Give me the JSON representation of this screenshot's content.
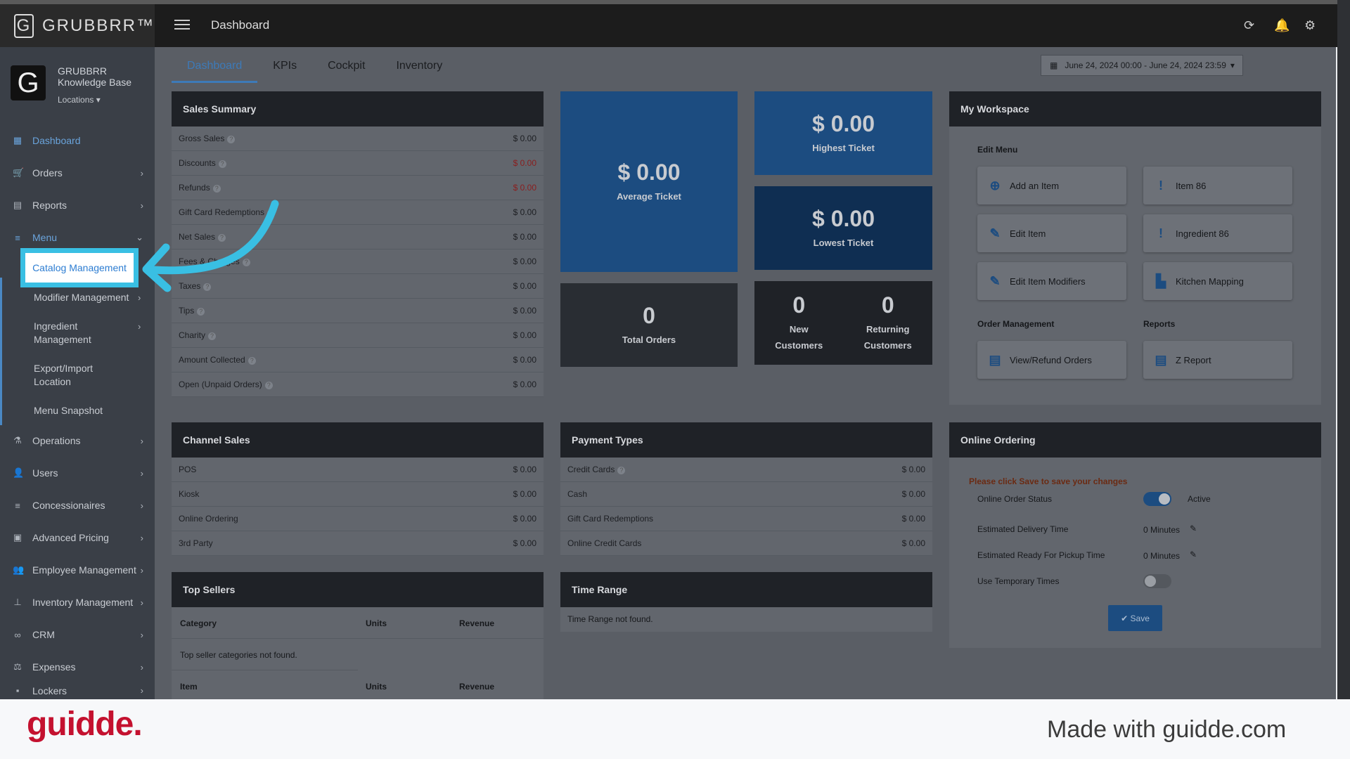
{
  "app": {
    "logo_text": "GRUBBRR™",
    "page_title": "Dashboard"
  },
  "topbar_icons": [
    "refresh-icon",
    "bell-icon",
    "gear-icon"
  ],
  "sidebar": {
    "brand_name_line1": "GRUBBRR",
    "brand_name_line2": "Knowledge Base",
    "locations": "Locations ▾",
    "items": [
      {
        "label": "Dashboard",
        "icon": "dashboard-icon"
      },
      {
        "label": "Orders",
        "icon": "cart-icon"
      },
      {
        "label": "Reports",
        "icon": "report-icon"
      },
      {
        "label": "Menu",
        "icon": "list-icon"
      },
      {
        "label": "Operations",
        "icon": "flask-icon"
      },
      {
        "label": "Users",
        "icon": "users-icon"
      },
      {
        "label": "Concessionaires",
        "icon": "list-icon"
      },
      {
        "label": "Advanced Pricing",
        "icon": "money-icon"
      },
      {
        "label": "Employee Management",
        "icon": "group-icon"
      },
      {
        "label": "Inventory Management",
        "icon": "sitemap-icon"
      },
      {
        "label": "CRM",
        "icon": "link-icon"
      },
      {
        "label": "Expenses",
        "icon": "scale-icon"
      },
      {
        "label": "Lockers",
        "icon": "lock-icon"
      }
    ],
    "menu_sub": {
      "catalog": "Catalog Management",
      "modifier": "Modifier Management",
      "ingredient_l1": "Ingredient",
      "ingredient_l2": "Management",
      "export_l1": "Export/Import",
      "export_l2": "Location",
      "snapshot": "Menu Snapshot"
    }
  },
  "tabs": [
    "Dashboard",
    "KPIs",
    "Cockpit",
    "Inventory"
  ],
  "date_range": "June 24, 2024 00:00 - June 24, 2024 23:59",
  "sales_summary": {
    "title": "Sales Summary",
    "rows": [
      {
        "label": "Gross Sales",
        "value": "$ 0.00"
      },
      {
        "label": "Discounts",
        "value": "$ 0.00"
      },
      {
        "label": "Refunds",
        "value": "$ 0.00"
      },
      {
        "label": "Gift Card Redemptions",
        "value": "$ 0.00"
      },
      {
        "label": "Net Sales",
        "value": "$ 0.00"
      },
      {
        "label": "Fees & Charges",
        "value": "$ 0.00"
      },
      {
        "label": "Taxes",
        "value": "$ 0.00"
      },
      {
        "label": "Tips",
        "value": "$ 0.00"
      },
      {
        "label": "Charity",
        "value": "$ 0.00"
      },
      {
        "label": "Amount Collected",
        "value": "$ 0.00"
      },
      {
        "label": "Open (Unpaid Orders)",
        "value": "$ 0.00"
      }
    ]
  },
  "kpis": {
    "average": {
      "value": "$ 0.00",
      "label": "Average Ticket"
    },
    "highest": {
      "value": "$ 0.00",
      "label": "Highest Ticket"
    },
    "lowest": {
      "value": "$ 0.00",
      "label": "Lowest Ticket"
    },
    "total_orders": {
      "value": "0",
      "label": "Total Orders"
    },
    "new_customers": {
      "value": "0",
      "label_l1": "New",
      "label_l2": "Customers"
    },
    "returning_customers": {
      "value": "0",
      "label_l1": "Returning",
      "label_l2": "Customers"
    }
  },
  "workspace": {
    "title": "My Workspace",
    "edit_menu_label": "Edit Menu",
    "order_mgmt_label": "Order Management",
    "reports_label": "Reports",
    "buttons": {
      "add_item": "Add an Item",
      "item86": "Item 86",
      "edit_item": "Edit Item",
      "ingredient86": "Ingredient 86",
      "edit_modifiers": "Edit Item Modifiers",
      "kitchen": "Kitchen Mapping",
      "refund": "View/Refund Orders",
      "zreport": "Z Report"
    }
  },
  "channel_sales": {
    "title": "Channel Sales",
    "rows": [
      {
        "label": "POS",
        "value": "$ 0.00"
      },
      {
        "label": "Kiosk",
        "value": "$ 0.00"
      },
      {
        "label": "Online Ordering",
        "value": "$ 0.00"
      },
      {
        "label": "3rd Party",
        "value": "$ 0.00"
      }
    ]
  },
  "payment_types": {
    "title": "Payment Types",
    "rows": [
      {
        "label": "Credit Cards",
        "value": "$ 0.00"
      },
      {
        "label": "Cash",
        "value": "$ 0.00"
      },
      {
        "label": "Gift Card Redemptions",
        "value": "$ 0.00"
      },
      {
        "label": "Online Credit Cards",
        "value": "$ 0.00"
      }
    ]
  },
  "online_ordering": {
    "title": "Online Ordering",
    "notice": "Please click Save to save your changes",
    "status_label": "Online Order Status",
    "status_value": "Active",
    "delivery_label": "Estimated Delivery Time",
    "delivery_value": "0 Minutes",
    "pickup_label": "Estimated Ready For Pickup Time",
    "pickup_value": "0 Minutes",
    "temp_label": "Use Temporary Times",
    "save": "✔ Save"
  },
  "top_sellers": {
    "title": "Top Sellers",
    "col_category": "Category",
    "col_units": "Units",
    "col_revenue": "Revenue",
    "empty": "Top seller categories not found.",
    "col_item": "Item"
  },
  "time_range": {
    "title": "Time Range",
    "empty": "Time Range not found."
  },
  "footer": {
    "brand": "guidde.",
    "made_with": "Made with guidde.com"
  }
}
